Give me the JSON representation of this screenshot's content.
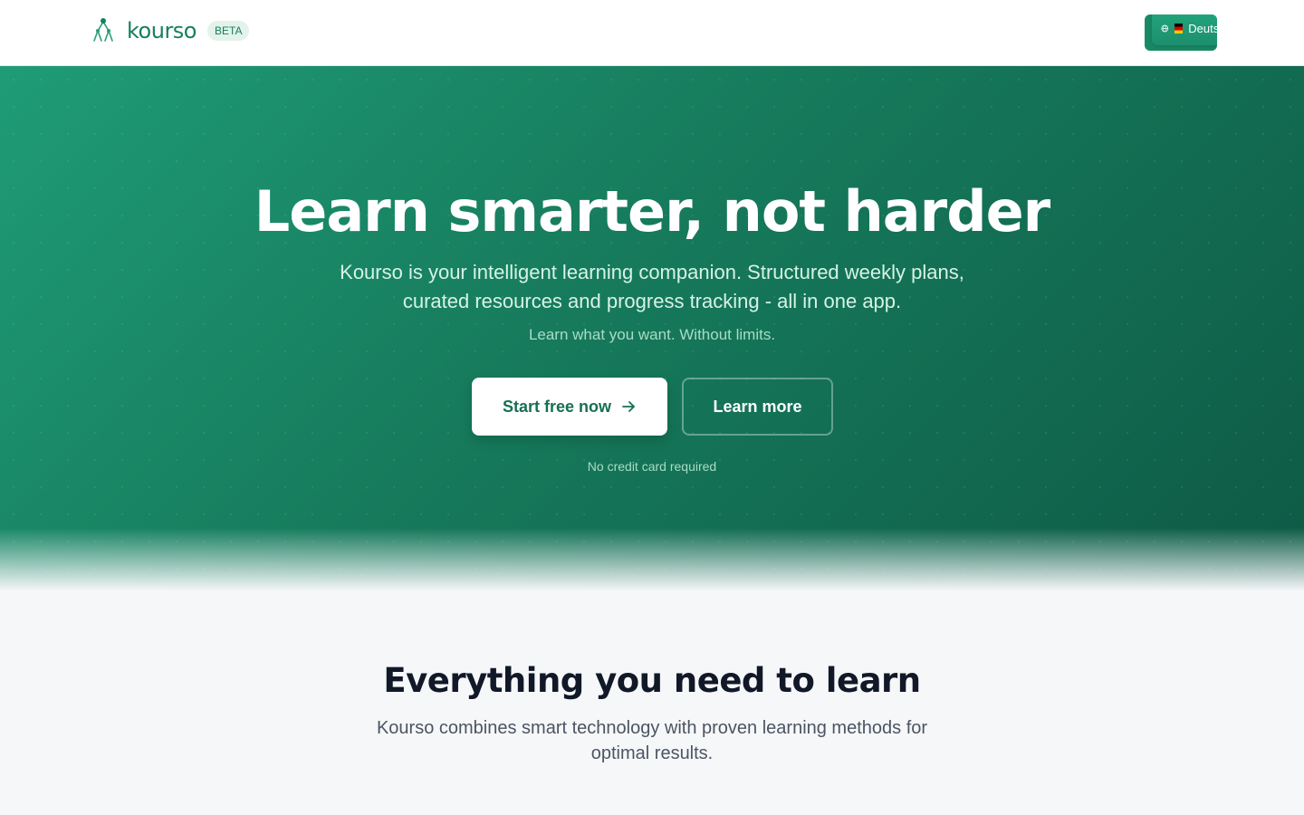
{
  "header": {
    "brand": "kourso",
    "badge": "BETA",
    "language": {
      "label": "Deutsch",
      "icon": "globe-icon",
      "flag": "de-flag"
    }
  },
  "hero": {
    "title": "Learn smarter, not harder",
    "subtitle": "Kourso is your intelligent learning companion. Structured weekly plans, curated resources and progress tracking - all in one app.",
    "tagline": "Learn what you want. Without limits.",
    "primary_cta": "Start free now",
    "secondary_cta": "Learn more",
    "note": "No credit card required"
  },
  "features": {
    "title": "Everything you need to learn",
    "subtitle": "Kourso combines smart technology with proven learning methods for optimal results."
  },
  "colors": {
    "brand": "#15805e",
    "hero_start": "#1f9c76",
    "hero_end": "#0e5a45",
    "background": "#f6f7f9"
  }
}
